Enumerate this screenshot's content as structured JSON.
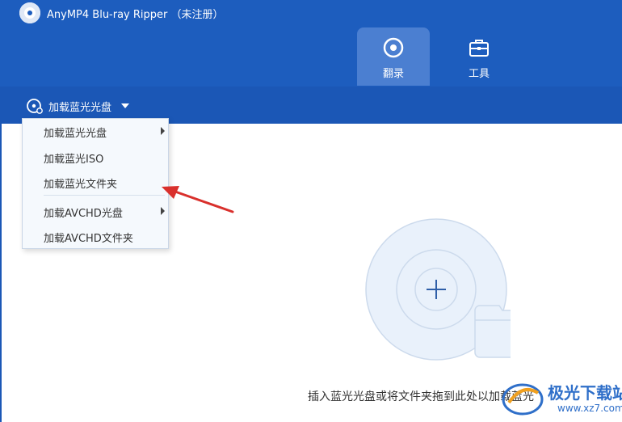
{
  "window": {
    "title": "AnyMP4 Blu-ray Ripper （未注册）"
  },
  "tabs": [
    {
      "label": "翻录",
      "icon": "ripper-icon",
      "active": true
    },
    {
      "label": "工具",
      "icon": "toolbox-icon",
      "active": false
    }
  ],
  "toolbar": {
    "load_label": "加载蓝光光盘"
  },
  "menu": {
    "items": [
      {
        "label": "加载蓝光光盘",
        "has_submenu": true
      },
      {
        "label": "加载蓝光ISO",
        "has_submenu": false
      },
      {
        "label": "加载蓝光文件夹",
        "has_submenu": false
      },
      {
        "label": "加载AVCHD光盘",
        "has_submenu": true
      },
      {
        "label": "加载AVCHD文件夹",
        "has_submenu": false
      }
    ]
  },
  "main": {
    "drop_hint": "插入蓝光光盘或将文件夹拖到此处以加载蓝光"
  },
  "watermark": {
    "text": "极光下载站",
    "url": "www.xz7.com"
  },
  "colors": {
    "header": "#1d5dbe",
    "subbar": "#1b57b6",
    "tab_active": "#4b7fd1",
    "annotation_arrow": "#d9302c"
  }
}
